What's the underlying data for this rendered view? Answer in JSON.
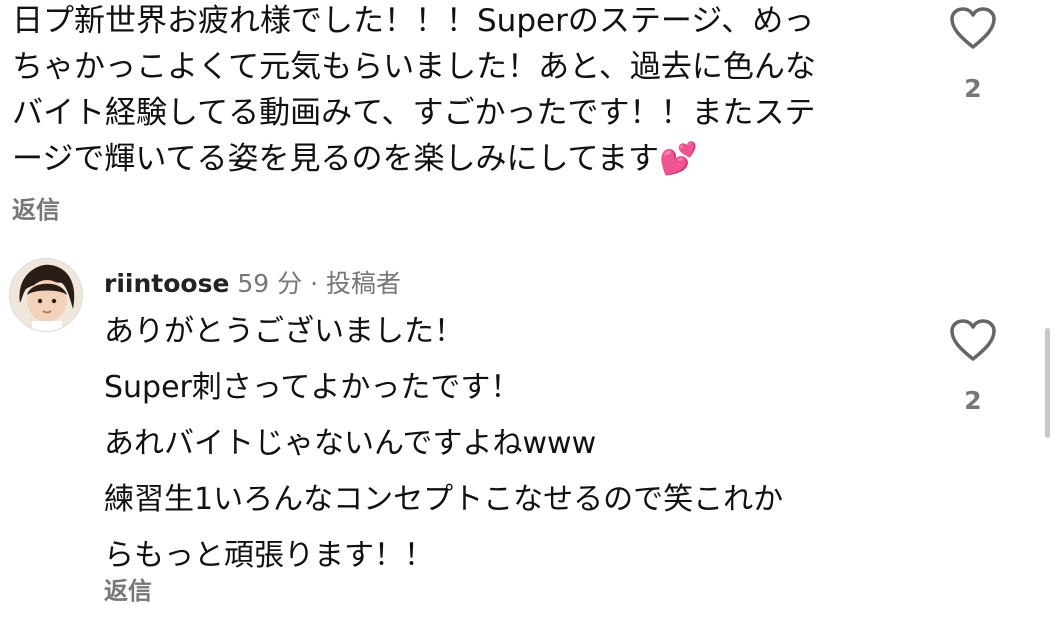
{
  "comment1": {
    "lines": [
      "日プ新世界お疲れ様でした！！！Superのステージ、めっ",
      "ちゃかっこよくて元気もらいました！あと、過去に色んな",
      "バイト経験してる動画みて、すごかったです！！またステ",
      "ージで輝いてる姿を見るのを楽しみにしてます💕"
    ],
    "reply_label": "返信",
    "like_count": "2",
    "like_icon": "heart-outline-icon"
  },
  "comment2": {
    "username": "riintoose",
    "time": "59 分",
    "separator": "·",
    "badge": "投稿者",
    "lines": [
      "ありがとうございました！",
      "Super刺さってよかったです！",
      "あれバイトじゃないんですよねwww",
      "練習生1いろんなコンセプトこなせるので笑これか",
      "らもっと頑張ります！！"
    ],
    "reply_label": "返信",
    "like_count": "2",
    "like_icon": "heart-outline-icon"
  },
  "colors": {
    "text": "#111111",
    "secondary": "#777777",
    "background": "#ffffff"
  }
}
